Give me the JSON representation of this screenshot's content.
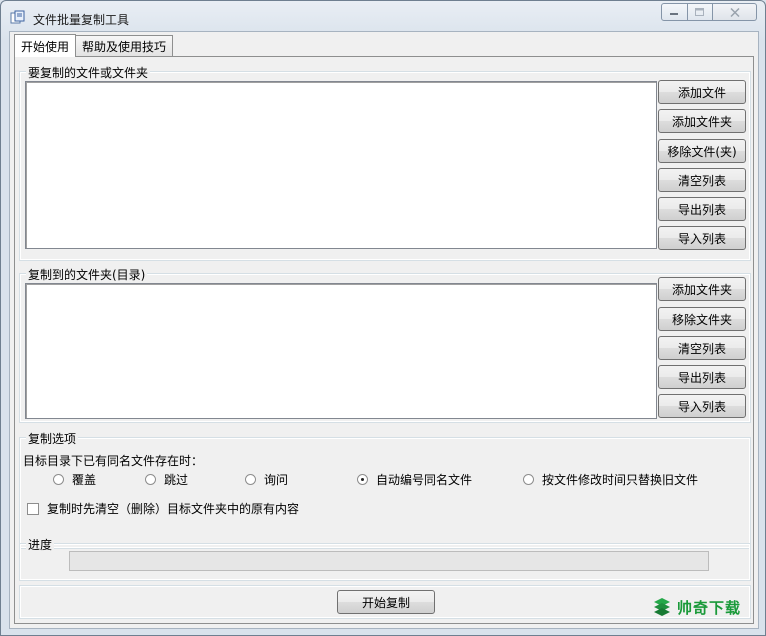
{
  "window": {
    "title": "文件批量复制工具"
  },
  "tabs": [
    {
      "label": "开始使用",
      "active": true
    },
    {
      "label": "帮助及使用技巧",
      "active": false
    }
  ],
  "source_group": {
    "label": "要复制的文件或文件夹",
    "buttons": [
      "添加文件",
      "添加文件夹",
      "移除文件(夹)",
      "清空列表",
      "导出列表",
      "导入列表"
    ]
  },
  "dest_group": {
    "label": "复制到的文件夹(目录)",
    "buttons": [
      "添加文件夹",
      "移除文件夹",
      "清空列表",
      "导出列表",
      "导入列表"
    ]
  },
  "options_group": {
    "label": "复制选项",
    "prompt": "目标目录下已有同名文件存在时：",
    "radios": [
      {
        "label": "覆盖",
        "checked": false
      },
      {
        "label": "跳过",
        "checked": false
      },
      {
        "label": "询问",
        "checked": false
      },
      {
        "label": "自动编号同名文件",
        "checked": true
      },
      {
        "label": "按文件修改时间只替换旧文件",
        "checked": false
      }
    ],
    "clear_checkbox": {
      "label": "复制时先清空（删除）目标文件夹中的原有内容",
      "checked": false
    }
  },
  "progress_group": {
    "label": "进度",
    "value": 0
  },
  "start_button": {
    "label": "开始复制"
  },
  "watermark": {
    "text": "帅奇下载"
  }
}
